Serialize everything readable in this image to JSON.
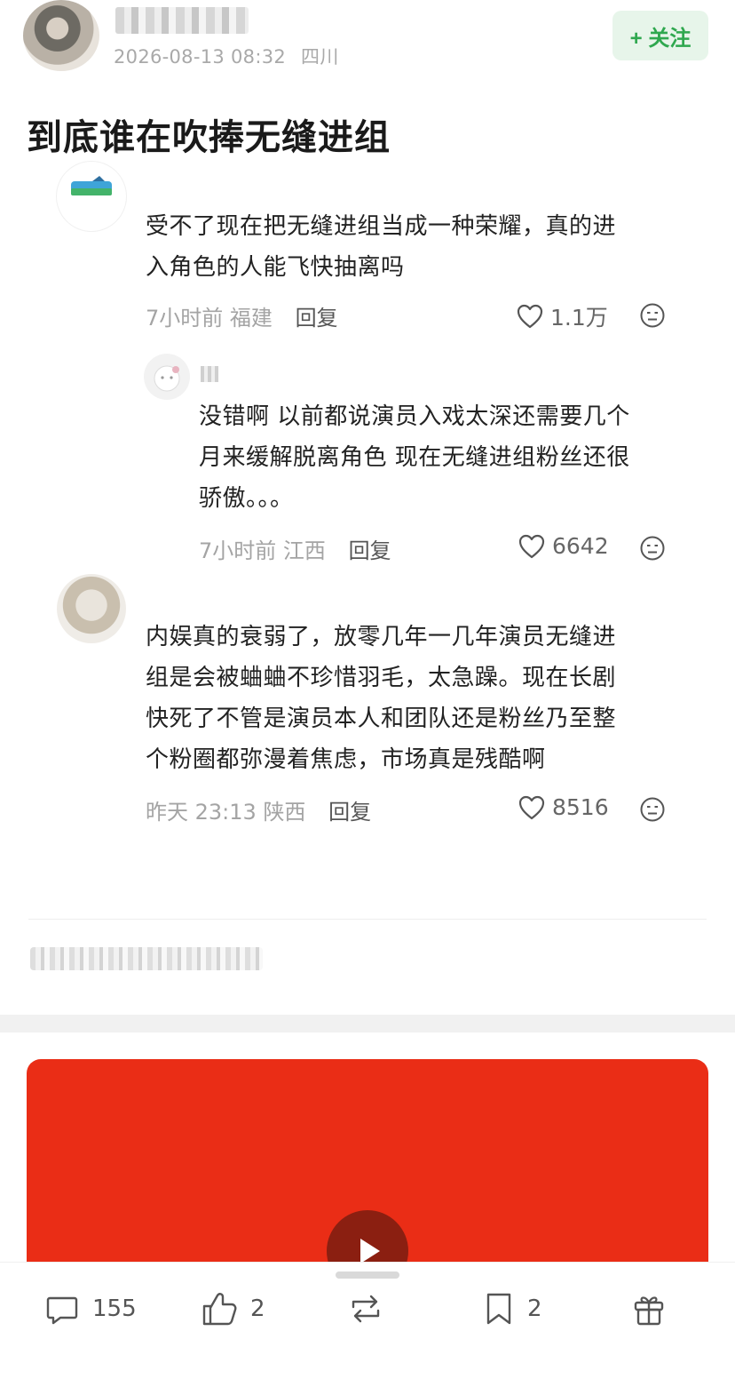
{
  "author": {
    "date": "2026-08-13 08:32",
    "location": "四川",
    "follow_label": "+ 关注"
  },
  "post": {
    "title": "到底谁在吹捧无缝进组"
  },
  "comments": [
    {
      "text_line1": "受不了现在把无缝进组当成一种荣耀，真的进",
      "text_line2": "入角色的人能飞快抽离吗",
      "time": "7小时前",
      "location": "福建",
      "reply_label": "回复",
      "likes": "1.1万",
      "reply": {
        "text_line1": "没错啊 以前都说演员入戏太深还需要几个",
        "text_line2": "月来缓解脱离角色 现在无缝进组粉丝还很",
        "text_line3": "骄傲。。。",
        "time": "7小时前",
        "location": "江西",
        "reply_label": "回复",
        "likes": "6642"
      }
    },
    {
      "text_line1": "内娱真的衰弱了，放零几年一几年演员无缝进",
      "text_line2": "组是会被蛐蛐不珍惜羽毛，太急躁。现在长剧",
      "text_line3": "快死了不管是演员本人和团队还是粉丝乃至整",
      "text_line4": "个粉圈都弥漫着焦虑，市场真是残酷啊",
      "time": "昨天 23:13",
      "location": "陕西",
      "reply_label": "回复",
      "likes": "8516"
    }
  ],
  "bottom_bar": {
    "comments_count": "155",
    "likes_count": "2",
    "favorites_count": "2"
  },
  "icons": [
    "heart-icon",
    "emoji-icon",
    "comment-icon",
    "thumb-up-icon",
    "repost-icon",
    "bookmark-icon",
    "gift-icon",
    "play-icon"
  ],
  "colors": {
    "follow_green": "#2fa84f",
    "follow_bg": "#e7f5ea",
    "video_red": "#ea2d16"
  }
}
